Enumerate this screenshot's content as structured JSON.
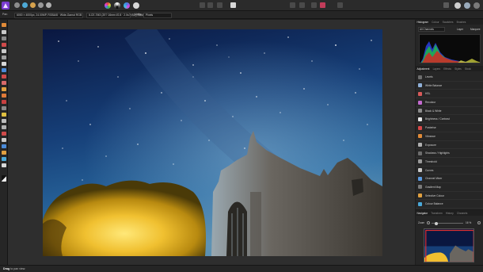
{
  "toolbar": {
    "persona_icons": [
      "photo-persona-icon",
      "liquify-persona-icon",
      "develop-persona-icon",
      "tone-mapping-persona-icon",
      "export-persona-icon"
    ],
    "colors": {
      "accent": "#c23cd1",
      "background": "#2b2b2b"
    }
  },
  "context_bar": {
    "pan_label": "Pan",
    "document_info": "6000 × 4000px, 24.00MP, RGBA/8 · Wide-Gamut RGB",
    "camera_info": "ILCE-7M3 (2E? 16mm f/2.8 · 2.0s? ISO) SAM",
    "units_label": "Units",
    "units_value": "Pixels"
  },
  "histogram_panel": {
    "tabs": [
      "Histogram",
      "Colour",
      "Swatches",
      "Brushes"
    ],
    "channel_select": "All Channels",
    "layer_label": "Layer",
    "marquee_label": "Marquee"
  },
  "adjustment_panel": {
    "tabs": [
      "Adjustment",
      "Layers",
      "Effects",
      "Styles",
      "Stock"
    ],
    "items": [
      {
        "label": "Levels",
        "icon": "levels-icon",
        "color": "#6d6d6d"
      },
      {
        "label": "White Balance",
        "icon": "white-balance-icon",
        "color": "#8fb0d8"
      },
      {
        "label": "HSL",
        "icon": "hsl-icon",
        "color": "#d85a5a"
      },
      {
        "label": "Recolour",
        "icon": "recolour-icon",
        "color": "#c46ad0"
      },
      {
        "label": "Black & White",
        "icon": "black-white-icon",
        "color": "#8c8c8c"
      },
      {
        "label": "Brightness / Contrast",
        "icon": "brightness-contrast-icon",
        "color": "#e8e8e8"
      },
      {
        "label": "Posterise",
        "icon": "posterise-icon",
        "color": "#d84848"
      },
      {
        "label": "Vibrance",
        "icon": "vibrance-icon",
        "color": "#e08a38"
      },
      {
        "label": "Exposure",
        "icon": "exposure-icon",
        "color": "#b0b0b0"
      },
      {
        "label": "Shadows / Highlights",
        "icon": "shadows-highlights-icon",
        "color": "#6d6d6d"
      },
      {
        "label": "Threshold",
        "icon": "threshold-icon",
        "color": "#9a9a9a"
      },
      {
        "label": "Curves",
        "icon": "curves-icon",
        "color": "#c8c8c8"
      },
      {
        "label": "Channel Mixer",
        "icon": "channel-mixer-icon",
        "color": "#5a9ae0"
      },
      {
        "label": "Gradient Map",
        "icon": "gradient-map-icon",
        "color": "#7a7a7a"
      },
      {
        "label": "Selective Colour",
        "icon": "selective-colour-icon",
        "color": "#e0a040"
      },
      {
        "label": "Colour Balance",
        "icon": "colour-balance-icon",
        "color": "#4aa8d8"
      }
    ]
  },
  "navigator_panel": {
    "tabs": [
      "Navigator",
      "Transform",
      "History",
      "Channels"
    ],
    "zoom_label": "Zoom",
    "zoom_value": "16 %"
  },
  "status_bar": {
    "action": "Drag",
    "hint": "to pan view."
  }
}
